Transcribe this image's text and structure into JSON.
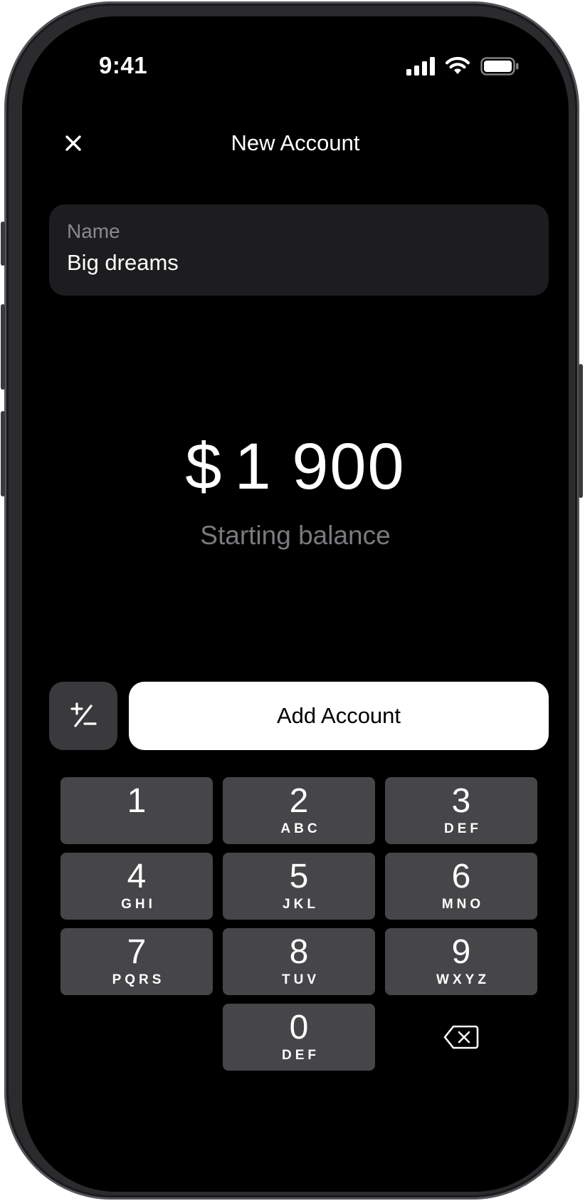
{
  "status_bar": {
    "time": "9:41",
    "icons": [
      "cellular-signal-icon",
      "wifi-icon",
      "battery-icon"
    ]
  },
  "nav": {
    "close_icon": "close-icon",
    "title": "New Account"
  },
  "name_field": {
    "label": "Name",
    "value": "Big dreams"
  },
  "balance": {
    "currency": "$",
    "amount": "1 900",
    "caption": "Starting balance"
  },
  "actions": {
    "sign_toggle_icon": "plus-minus-icon",
    "primary_label": "Add Account"
  },
  "keypad": {
    "keys": [
      {
        "digit": "1",
        "letters": ""
      },
      {
        "digit": "2",
        "letters": "ABC"
      },
      {
        "digit": "3",
        "letters": "DEF"
      },
      {
        "digit": "4",
        "letters": "GHI"
      },
      {
        "digit": "5",
        "letters": "JKL"
      },
      {
        "digit": "6",
        "letters": "MNO"
      },
      {
        "digit": "7",
        "letters": "PQRS"
      },
      {
        "digit": "8",
        "letters": "TUV"
      },
      {
        "digit": "9",
        "letters": "WXYZ"
      },
      {
        "digit": "0",
        "letters": "DEF"
      }
    ],
    "delete_icon": "backspace-icon"
  },
  "colors": {
    "background": "#000000",
    "field_background": "#1d1d1f",
    "key_background": "#464649",
    "primary_button": "#ffffff",
    "secondary_text": "#7a7a7e"
  }
}
